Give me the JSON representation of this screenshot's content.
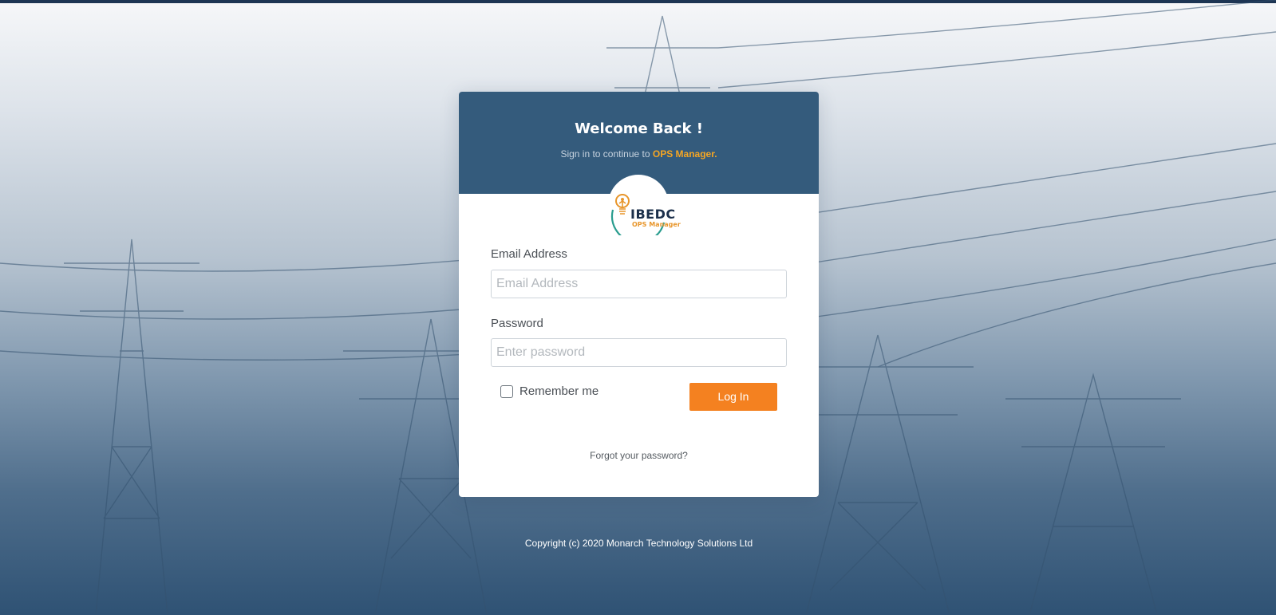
{
  "header": {
    "welcome": "Welcome Back !",
    "subtitle_prefix": "Sign in to continue to ",
    "subtitle_brand": "OPS Manager."
  },
  "logo": {
    "icon": "lightbulb-person-icon",
    "name": "IBEDC",
    "sub": "OPS Manager"
  },
  "form": {
    "email_label": "Email Address",
    "email_placeholder": "Email Address",
    "email_value": "",
    "password_label": "Password",
    "password_placeholder": "Enter password",
    "password_value": "",
    "remember_label": "Remember me",
    "remember_checked": false,
    "login_label": "Log In",
    "forgot_label": "Forgot your password?"
  },
  "footer": {
    "copyright": "Copyright (c) 2020 Monarch Technology Solutions Ltd"
  },
  "colors": {
    "header_bg": "#345b7c",
    "accent": "#f48120",
    "brand_text": "#f5a623",
    "top_bar": "#1d3553"
  }
}
